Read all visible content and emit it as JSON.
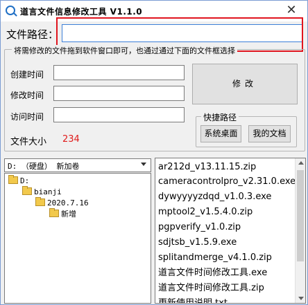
{
  "window": {
    "title": "道言文件信息修改工具 V1.1.0",
    "close_glyph": "✕"
  },
  "path": {
    "label": "文件路径：",
    "value": ""
  },
  "info_group": {
    "legend": "将需修改的文件拖到软件窗口即可，也通过通过下面的文件框选择",
    "created_label": "创建时间",
    "created_value": "",
    "modified_label": "修改时间",
    "modified_value": "",
    "accessed_label": "访问时间",
    "accessed_value": "",
    "size_label": "文件大小",
    "size_value": "234",
    "modify_button": "修改"
  },
  "quick_paths": {
    "legend": "快捷路径",
    "desktop_button": "系统桌面",
    "documents_button": "我的文档"
  },
  "drive_select": {
    "selected": "D: （硬盘） 新加卷"
  },
  "folder_tree": [
    {
      "label": "D:"
    },
    {
      "label": "bianji"
    },
    {
      "label": "2020.7.16"
    },
    {
      "label": "新增"
    }
  ],
  "file_list": [
    {
      "name": "ar212d_v13.11.15.zip"
    },
    {
      "name": "cameracontrolpro_v2.31.0.exe"
    },
    {
      "name": "dywyyyyzdqd_v1.0.3.exe"
    },
    {
      "name": "mptool2_v1.5.4.0.zip"
    },
    {
      "name": "pgpverify_v1.0.zip"
    },
    {
      "name": "sdjtsb_v1.5.9.exe"
    },
    {
      "name": "splitandmerge_v4.1.0.zip"
    },
    {
      "name": "道言文件时间修改工具.exe"
    },
    {
      "name": "道言文件时间修改工具.zip"
    },
    {
      "name": "更新使用说明.txt"
    }
  ],
  "colors": {
    "size_value": "#e01a1a",
    "highlight_box": "#e0141e",
    "accent": "#1f6fc5"
  }
}
